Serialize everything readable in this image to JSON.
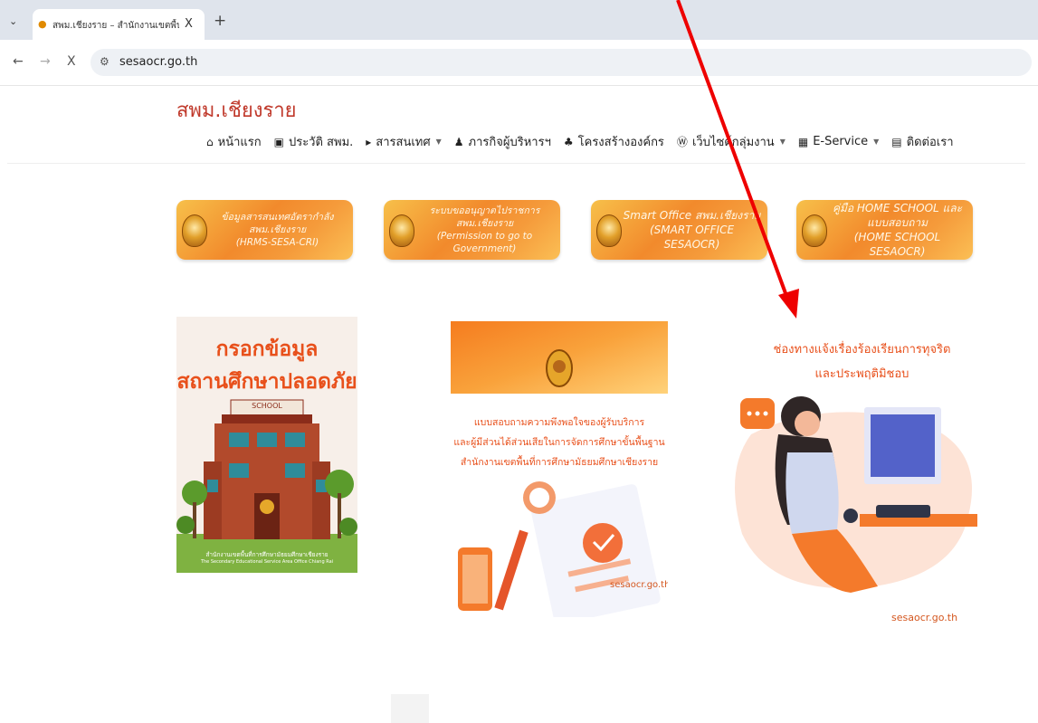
{
  "browser": {
    "tab_title": "สพม.เชียงราย – สำนักงานเขตพื้นที่การ",
    "url": "sesaocr.go.th",
    "close_tab_symbol": "X",
    "new_tab_symbol": "+",
    "stop_symbol": "X"
  },
  "site": {
    "title": "สพม.เชียงราย",
    "menu": [
      {
        "icon": "home-icon",
        "label": "หน้าแรก",
        "has_dropdown": false
      },
      {
        "icon": "history-icon",
        "label": "ประวัติ สพม.",
        "has_dropdown": false
      },
      {
        "icon": "info-icon",
        "label": "สารสนเทศ",
        "has_dropdown": true
      },
      {
        "icon": "person-icon",
        "label": "ภารกิจผู้บริหารฯ",
        "has_dropdown": false
      },
      {
        "icon": "org-chart-icon",
        "label": "โครงสร้างองค์กร",
        "has_dropdown": false
      },
      {
        "icon": "wordpress-icon",
        "label": "เว็บไซต์กลุ่มงาน",
        "has_dropdown": true
      },
      {
        "icon": "grid-icon",
        "label": "E-Service",
        "has_dropdown": true
      },
      {
        "icon": "chat-icon",
        "label": "ติดต่อเรา",
        "has_dropdown": false
      }
    ]
  },
  "banners": [
    {
      "lines": [
        "ข้อมูลสารสนเทศอัตรากำลัง",
        "สพม.เชียงราย",
        "(HRMS-SESA-CRI)"
      ]
    },
    {
      "lines": [
        "ระบบขออนุญาตไปราชการ สพม.เชียงราย",
        "(Permission to go to Government)"
      ]
    },
    {
      "lines": [
        "Smart Office สพม.เชียงราย",
        "(SMART OFFICE SESAOCR)"
      ]
    },
    {
      "lines": [
        "คู่มือ HOME SCHOOL และแบบสอบถาม",
        "(HOME SCHOOL SESAOCR)"
      ]
    }
  ],
  "posters": {
    "safe_school": {
      "title_lines": [
        "กรอกข้อมูล",
        "สถานศึกษาปลอดภัย"
      ],
      "sign": "SCHOOL",
      "footer_th": "สำนักงานเขตพื้นที่การศึกษามัธยมศึกษาเชียงราย",
      "footer_en": "The Secondary Educational Service Area Office Chiang Rai"
    },
    "survey": {
      "lines": [
        "แบบสอบถามความพึงพอใจของผู้รับบริการ",
        "และผู้มีส่วนได้ส่วนเสียในการจัดการศึกษาขั้นพื้นฐาน",
        "สำนักงานเขตพื้นที่การศึกษามัธยมศึกษาเชียงราย"
      ],
      "url": "sesaocr.go.th"
    },
    "complaint": {
      "lines": [
        "ช่องทางแจ้งเรื่องร้องเรียนการทุจริต",
        "และประพฤติมิชอบ"
      ],
      "url": "sesaocr.go.th"
    }
  },
  "colors": {
    "title_red": "#c0392b",
    "poster_orange": "#e8501b",
    "arrow_red": "#ee0000"
  }
}
